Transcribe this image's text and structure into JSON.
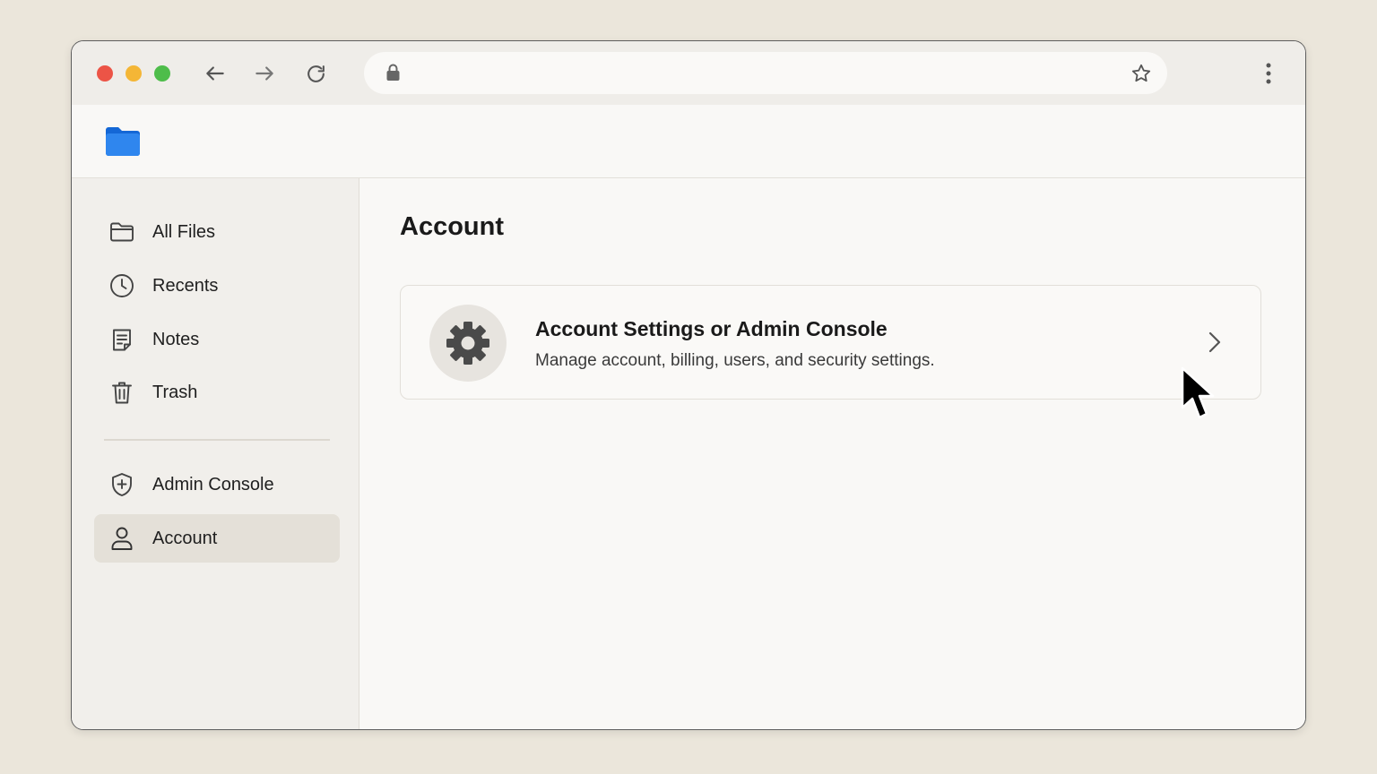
{
  "browser": {
    "url": "",
    "icons": {
      "back": "arrow-left-icon",
      "forward": "arrow-right-icon",
      "reload": "reload-icon",
      "lock": "lock-icon",
      "bookmark": "star-icon",
      "menu": "more-vert-icon"
    }
  },
  "app": {
    "logo_icon": "folder-icon",
    "brand_color": "#1a73e8"
  },
  "sidebar": {
    "items": [
      {
        "label": "All Files",
        "icon": "folder-outline-icon"
      },
      {
        "label": "Recents",
        "icon": "clock-icon"
      },
      {
        "label": "Notes",
        "icon": "note-icon"
      },
      {
        "label": "Trash",
        "icon": "trash-icon"
      },
      {
        "label": "Admin Console",
        "icon": "shield-icon"
      },
      {
        "label": "Account",
        "icon": "user-icon",
        "active": true
      }
    ]
  },
  "main": {
    "title": "Account",
    "card": {
      "title": "Account Settings or Admin Console",
      "description": "Manage account, billing, users, and security settings.",
      "icon": "gear-icon"
    }
  }
}
